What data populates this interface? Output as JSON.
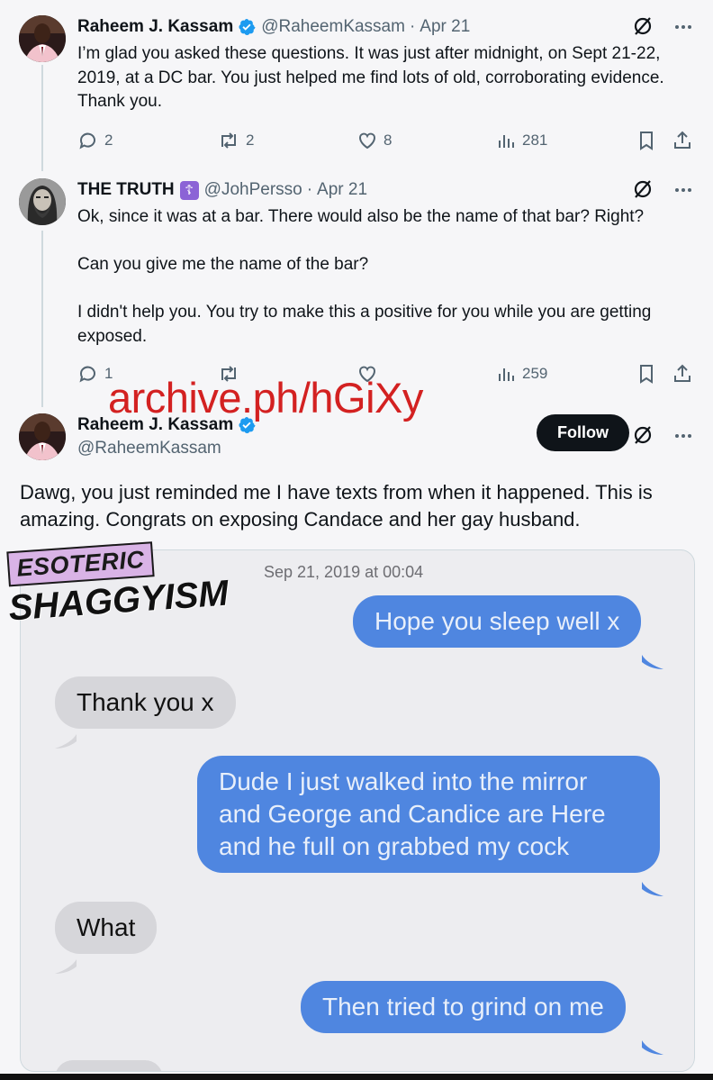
{
  "tweet1": {
    "name": "Raheem J. Kassam",
    "handle": "@RaheemKassam",
    "date": "Apr 21",
    "text": "I’m glad you asked these questions. It was just after midnight, on Sept 21-22, 2019, at a DC bar. You just helped me find lots of old, corroborating evidence. Thank you.",
    "replies": "2",
    "reposts": "2",
    "likes": "8",
    "views": "281"
  },
  "tweet2": {
    "name": "THE TRUTH",
    "badge": "☦",
    "handle": "@JohPersso",
    "date": "Apr 21",
    "text_lines": [
      "Ok, since it was at a bar. There would also be the name of that bar? Right?",
      "Can you give me the name of the bar?",
      "I didn't help you. You try to make this a positive for you while you are getting exposed."
    ],
    "replies": "1",
    "reposts": "",
    "likes": "",
    "views": "259"
  },
  "watermark": "archive.ph/hGiXy",
  "tweet3": {
    "name": "Raheem J. Kassam",
    "handle": "@RaheemKassam",
    "follow_label": "Follow",
    "text": "Dawg, you just reminded me I have texts from when it happened. This is amazing. Congrats on exposing Candace and her gay husband."
  },
  "brand": {
    "top": "ESOTERIC",
    "bottom": "SHAGGYISM"
  },
  "imessage": {
    "timestamp": "Sep 21, 2019 at 00:04",
    "messages": [
      {
        "dir": "out",
        "text": "Hope you sleep well x"
      },
      {
        "dir": "in",
        "text": "Thank you x"
      },
      {
        "dir": "out",
        "line1": "Dude I just walked into the mirror",
        "line2": "and George and Candice are Here",
        "line3": "and he full on grabbed my cock"
      },
      {
        "dir": "in",
        "text": "What"
      },
      {
        "dir": "out",
        "text": "Then tried to grind on me"
      }
    ]
  },
  "colors": {
    "verified": "#1d9bf0",
    "accent_red": "#d32121",
    "imessage_blue": "#4f86e0",
    "imessage_gray": "#d6d6da"
  }
}
